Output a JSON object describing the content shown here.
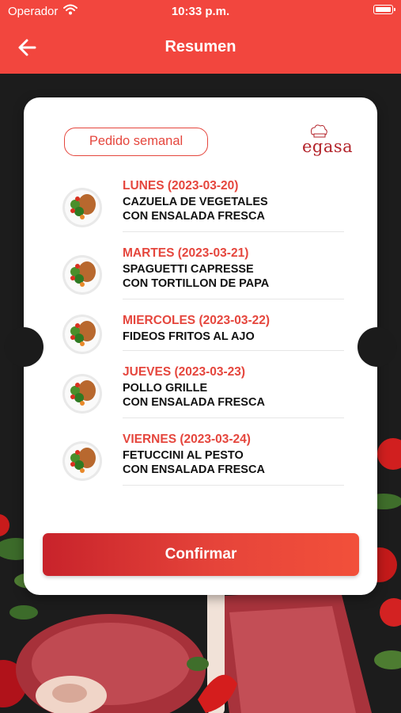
{
  "status_bar": {
    "carrier": "Operador",
    "time": "10:33 p.m."
  },
  "header": {
    "title": "Resumen",
    "back_icon": "arrow-left-icon"
  },
  "card": {
    "order_type": "Pedido semanal",
    "brand": "egasa",
    "menu": [
      {
        "day": "LUNES (2023-03-20)",
        "dish": [
          "CAZUELA DE VEGETALES",
          "CON ENSALADA FRESCA"
        ]
      },
      {
        "day": "MARTES (2023-03-21)",
        "dish": [
          "SPAGUETTI CAPRESSE",
          "CON TORTILLON DE PAPA"
        ]
      },
      {
        "day": "MIERCOLES (2023-03-22)",
        "dish": [
          "FIDEOS FRITOS AL AJO"
        ]
      },
      {
        "day": "JUEVES (2023-03-23)",
        "dish": [
          "POLLO GRILLE",
          "CON ENSALADA FRESCA"
        ]
      },
      {
        "day": "VIERNES (2023-03-24)",
        "dish": [
          "FETUCCINI AL PESTO",
          "CON ENSALADA FRESCA"
        ]
      }
    ],
    "confirm_label": "Confirmar"
  },
  "colors": {
    "header": "#f2463e",
    "accent": "#e5463d",
    "button_start": "#c8232b",
    "button_end": "#f2503a"
  }
}
